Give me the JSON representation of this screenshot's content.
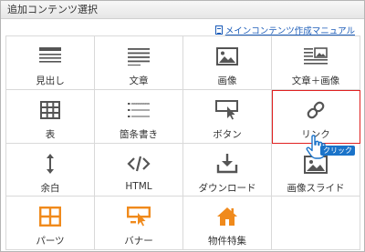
{
  "dialog": {
    "title": "追加コンテンツ選択",
    "manual_link": "メインコンテンツ作成マニュアル"
  },
  "items": [
    {
      "label": "見出し",
      "icon": "heading-icon"
    },
    {
      "label": "文章",
      "icon": "text-icon"
    },
    {
      "label": "画像",
      "icon": "image-icon"
    },
    {
      "label": "文章＋画像",
      "icon": "text-image-icon"
    },
    {
      "label": "表",
      "icon": "table-icon"
    },
    {
      "label": "箇条書き",
      "icon": "bullet-list-icon"
    },
    {
      "label": "ボタン",
      "icon": "button-icon"
    },
    {
      "label": "リンク",
      "icon": "link-icon"
    },
    {
      "label": "余白",
      "icon": "spacing-icon"
    },
    {
      "label": "HTML",
      "icon": "code-icon"
    },
    {
      "label": "ダウンロード",
      "icon": "download-icon"
    },
    {
      "label": "画像スライド",
      "icon": "image-slide-icon"
    },
    {
      "label": "パーツ",
      "icon": "parts-icon"
    },
    {
      "label": "バナー",
      "icon": "banner-icon"
    },
    {
      "label": "物件特集",
      "icon": "house-icon"
    }
  ],
  "cursor_badge": "クリック",
  "colors": {
    "icon_dark": "#555555",
    "icon_orange": "#f08a1c",
    "selected_border": "#e02020",
    "link_blue": "#1a5bb8",
    "badge_blue": "#1a73c9"
  }
}
